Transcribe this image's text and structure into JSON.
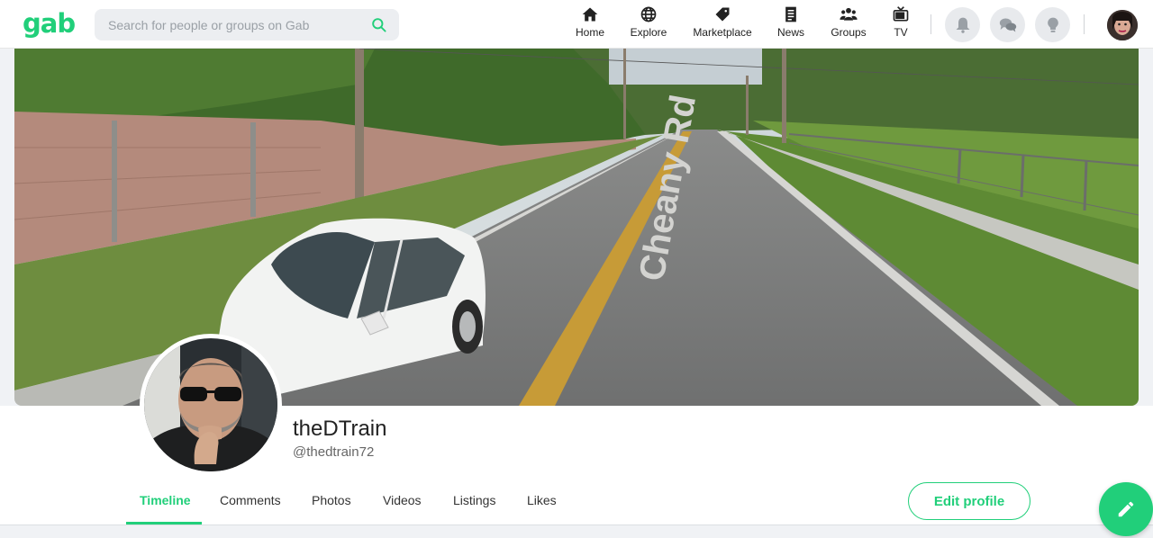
{
  "brand": {
    "logo_text": "gab",
    "accent": "#21cf7a"
  },
  "search": {
    "placeholder": "Search for people or groups on Gab",
    "value": ""
  },
  "nav": {
    "items": [
      {
        "label": "Home",
        "icon": "home-icon"
      },
      {
        "label": "Explore",
        "icon": "globe-icon"
      },
      {
        "label": "Marketplace",
        "icon": "tag-icon"
      },
      {
        "label": "News",
        "icon": "newspaper-icon"
      },
      {
        "label": "Groups",
        "icon": "groups-icon"
      },
      {
        "label": "TV",
        "icon": "tv-icon"
      }
    ],
    "actions": [
      "bell-icon",
      "chat-bubbles-icon",
      "lightbulb-icon"
    ]
  },
  "cover": {
    "street_text": "Cheany Rd"
  },
  "profile": {
    "display_name": "theDTrain",
    "username": "@thedtrain72"
  },
  "tabs": [
    {
      "label": "Timeline",
      "active": true
    },
    {
      "label": "Comments",
      "active": false
    },
    {
      "label": "Photos",
      "active": false
    },
    {
      "label": "Videos",
      "active": false
    },
    {
      "label": "Listings",
      "active": false
    },
    {
      "label": "Likes",
      "active": false
    }
  ],
  "edit_profile_label": "Edit profile",
  "compose_icon": "pencil-icon"
}
